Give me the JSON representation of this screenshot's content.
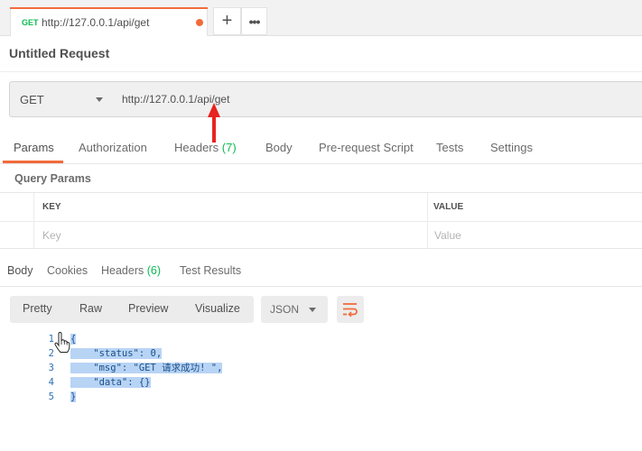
{
  "request_tab": {
    "method": "GET",
    "url": "http://127.0.0.1/api/get"
  },
  "tabstrip": {
    "add_label": "+",
    "more_label": "•••"
  },
  "request": {
    "title": "Untitled Request",
    "method": "GET",
    "url": "http://127.0.0.1/api/get"
  },
  "request_tabs": [
    {
      "label": "Params",
      "active": true
    },
    {
      "label": "Authorization"
    },
    {
      "label": "Headers",
      "count": "(7)"
    },
    {
      "label": "Body"
    },
    {
      "label": "Pre-request Script"
    },
    {
      "label": "Tests"
    },
    {
      "label": "Settings"
    }
  ],
  "query_params": {
    "title": "Query Params",
    "columns": [
      "KEY",
      "VALUE"
    ],
    "placeholders": {
      "key": "Key",
      "value": "Value"
    }
  },
  "response_tabs": [
    {
      "label": "Body",
      "active": true
    },
    {
      "label": "Cookies"
    },
    {
      "label": "Headers",
      "count": "(6)"
    },
    {
      "label": "Test Results"
    }
  ],
  "format_toolbar": {
    "modes": [
      "Pretty",
      "Raw",
      "Preview",
      "Visualize"
    ],
    "language": "JSON"
  },
  "response_body": {
    "line_numbers": [
      "1",
      "2",
      "3",
      "4",
      "5"
    ],
    "lines": [
      "{",
      "    \"status\": 0,",
      "    \"msg\": \"GET 请求成功! \",",
      "    \"data\": {}",
      "}"
    ]
  },
  "colors": {
    "accent": "#f26b3a",
    "get_method": "#0cbb52",
    "count_badge": "#0cbb52",
    "selection": "#b8d4f5",
    "annotation_arrow": "#e8231f"
  },
  "icons": [
    "plus-icon",
    "more-icon",
    "chevron-down-icon",
    "wrap-lines-icon",
    "hand-cursor-icon",
    "red-arrow-annotation"
  ]
}
